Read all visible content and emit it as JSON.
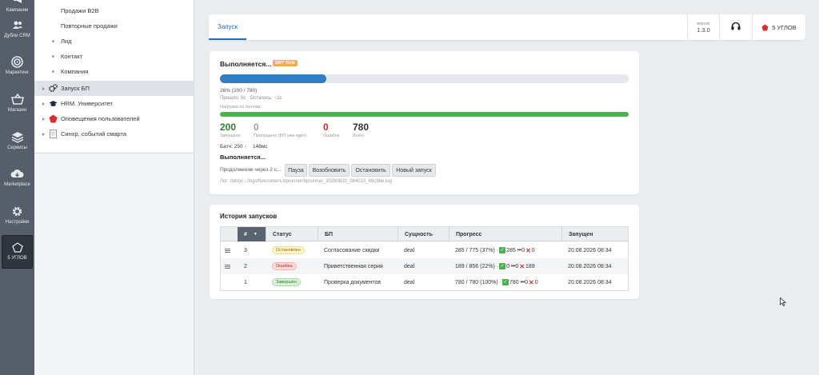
{
  "rail": {
    "items": [
      {
        "label": "Кампании",
        "icon": "megaphone-icon"
      },
      {
        "label": "Дубли CRM",
        "icon": "users-duplicate-icon"
      },
      {
        "label": "Маркетинг",
        "icon": "target-icon"
      },
      {
        "label": "Магазин",
        "icon": "basket-icon"
      },
      {
        "label": "Сервисы",
        "icon": "layers-icon"
      },
      {
        "label": "Marketplace",
        "icon": "cloud-download-icon"
      },
      {
        "label": "Настройки",
        "icon": "gear-icon"
      },
      {
        "label": "5 УГЛОВ",
        "icon": "star-outline-icon"
      }
    ]
  },
  "tree": {
    "items": [
      {
        "label": "Продажи B2B",
        "type": "leaf"
      },
      {
        "label": "Повторные продажи",
        "type": "leaf"
      },
      {
        "label": "Лид",
        "type": "leaf"
      },
      {
        "label": "Контакт",
        "type": "leaf"
      },
      {
        "label": "Компания",
        "type": "leaf"
      },
      {
        "label": "Запуск БП",
        "type": "node",
        "icon": "gears-icon",
        "selected": true
      },
      {
        "label": "HRM. Университет",
        "type": "node",
        "icon": "graduation-cap-icon"
      },
      {
        "label": "Оповещения пользователей",
        "type": "node",
        "icon": "red-star-icon"
      },
      {
        "label": "Синхр. событий смарта",
        "type": "node",
        "icon": "document-icon"
      }
    ]
  },
  "header": {
    "tab": "Запуск",
    "version_label": "версия",
    "version": "1.3.0",
    "brand": "5 УГЛОВ",
    "brand_color": "#d9302c"
  },
  "run": {
    "title": "Выполняется...",
    "badge": "DRY RUN",
    "progress_pct": 26,
    "progress_text": "26% (200 / 780)",
    "elapsed_text": "Прошло: 0с · Осталось: ~1с",
    "batch_load_label": "Нагрузка по батчам:",
    "batch_load_pct": 100,
    "stats": [
      {
        "value": "200",
        "caption": "Запущено",
        "color": "#2e7d32"
      },
      {
        "value": "0",
        "caption": "Пропущено (БП уже идёт)",
        "color": "#9e9e9e"
      },
      {
        "value": "0",
        "caption": "Ошибок",
        "color": "#c62828"
      },
      {
        "value": "780",
        "caption": "Всего",
        "color": "#333333"
      }
    ],
    "batch_text": "Батч: 250 ↑",
    "ms_text": "148мс",
    "status2": "Выполняется...",
    "continue_text": "Продолжение через 2 с...",
    "buttons": [
      "Пауза",
      "Возобновить",
      "Остановить",
      "Новый запуск"
    ],
    "log_text": "Лог: /bitrix/.../logs/fivecorners.bprunner/bprunner_20260820_084013_69c96e.log"
  },
  "history": {
    "title": "История запусков",
    "columns": [
      "#",
      "Статус",
      "БП",
      "Сущность",
      "Прогресс",
      "Запущен"
    ],
    "rows": [
      {
        "num": "3",
        "status": "Остановлен",
        "status_kind": "stop",
        "bp": "Согласование скидки",
        "entity": "deal",
        "progress": "285 / 775 (37%) ·",
        "ok": "285",
        "skip": "0",
        "err": "0",
        "started": "20.08.2026 08:34",
        "grip": true
      },
      {
        "num": "2",
        "status": "Ошибка",
        "status_kind": "err",
        "bp": "Приветственная серия",
        "entity": "deal",
        "progress": "189 / 856 (22%) ·",
        "ok": "0",
        "skip": "0",
        "err": "189",
        "started": "20.08.2026 08:34",
        "grip": true
      },
      {
        "num": "1",
        "status": "Завершён",
        "status_kind": "done",
        "bp": "Проверка документов",
        "entity": "deal",
        "progress": "780 / 780 (100%) ·",
        "ok": "780",
        "skip": "0",
        "err": "0",
        "started": "20.08.2026 08:34",
        "grip": false
      }
    ]
  }
}
